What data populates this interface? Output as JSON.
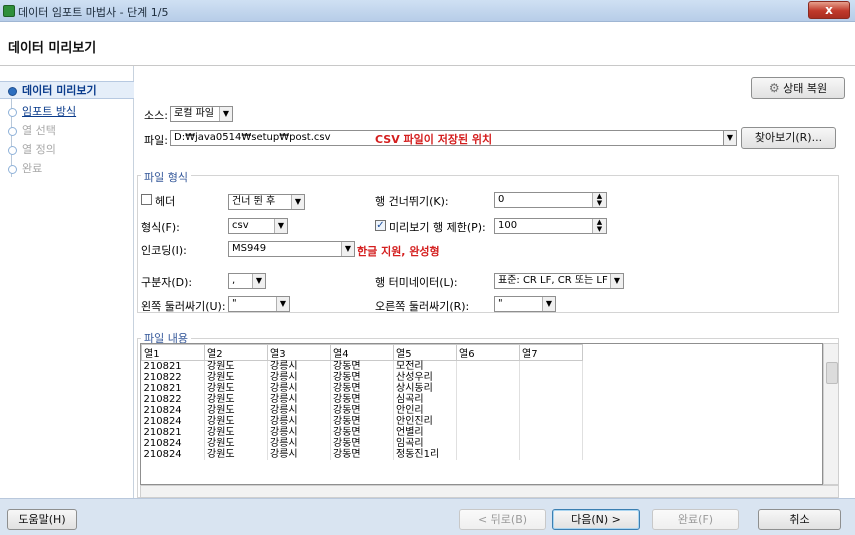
{
  "window": {
    "title": "데이터 임포트 마법사 - 단계 1/5",
    "close_glyph": "x"
  },
  "header": {
    "title": "데이터 미리보기"
  },
  "nav": {
    "items": [
      {
        "label": "데이터 미리보기"
      },
      {
        "label": "임포트 방식"
      },
      {
        "label": "열 선택"
      },
      {
        "label": "열 정의"
      },
      {
        "label": "완료"
      }
    ]
  },
  "toolbar": {
    "restore_label": "상태 복원"
  },
  "source": {
    "label": "소스:",
    "value": "로컬 파일"
  },
  "file": {
    "label": "파일:",
    "path": "D:₩java0514₩setup₩post.csv",
    "annotation": "CSV 파일이 저장된 위치",
    "browse_label": "찾아보기(R)..."
  },
  "file_format": {
    "group_title": "파일 형식",
    "header_label": "헤더",
    "header_mode": "건너 뛴 후",
    "skip_rows_label": "행 건너뛰기(K):",
    "skip_rows_value": "0",
    "format_label": "형식(F):",
    "format_value": "csv",
    "preview_limit_label": "미리보기 행 제한(P):",
    "preview_limit_value": "100",
    "encoding_label": "인코딩(I):",
    "encoding_value": "MS949",
    "encoding_annotation": "한글 지원, 완성형",
    "delimiter_label": "구분자(D):",
    "delimiter_value": ",",
    "terminator_label": "행 터미네이터(L):",
    "terminator_value": "표준: CR LF, CR 또는 LF",
    "left_enclosure_label": "왼쪽 둘러싸기(U):",
    "left_enclosure_value": "\"",
    "right_enclosure_label": "오른쪽 둘러싸기(R):",
    "right_enclosure_value": "\""
  },
  "file_content": {
    "group_title": "파일 내용",
    "columns": [
      "열1",
      "열2",
      "열3",
      "열4",
      "열5",
      "열6",
      "열7"
    ],
    "rows": [
      [
        "210821",
        "강원도",
        "강릉시",
        "강동면",
        "모전리",
        "",
        ""
      ],
      [
        "210822",
        "강원도",
        "강릉시",
        "강동면",
        "산성우리",
        "",
        ""
      ],
      [
        "210821",
        "강원도",
        "강릉시",
        "강동면",
        "상시동리",
        "",
        ""
      ],
      [
        "210822",
        "강원도",
        "강릉시",
        "강동면",
        "심곡리",
        "",
        ""
      ],
      [
        "210824",
        "강원도",
        "강릉시",
        "강동면",
        "안인리",
        "",
        ""
      ],
      [
        "210824",
        "강원도",
        "강릉시",
        "강동면",
        "안인진리",
        "",
        ""
      ],
      [
        "210821",
        "강원도",
        "강릉시",
        "강동면",
        "언별리",
        "",
        ""
      ],
      [
        "210824",
        "강원도",
        "강릉시",
        "강동면",
        "임곡리",
        "",
        ""
      ],
      [
        "210824",
        "강원도",
        "강릉시",
        "강동면",
        "정동진1리",
        "",
        ""
      ]
    ]
  },
  "footer": {
    "help_label": "도움말(H)",
    "back_label": "< 뒤로(B)",
    "next_label": "다음(N) >",
    "finish_label": "완료(F)",
    "cancel_label": "취소"
  },
  "icons": {
    "restore": "gears-icon",
    "app": "app-icon"
  }
}
